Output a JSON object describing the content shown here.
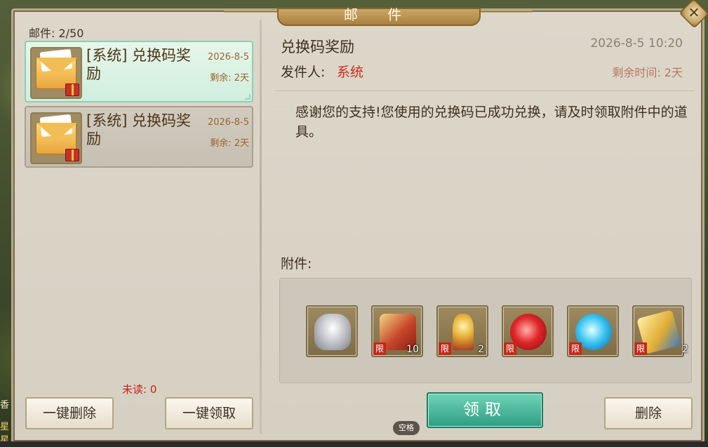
{
  "window": {
    "title": "邮 件"
  },
  "left": {
    "mail_count_label": "邮件: 2/50",
    "mails": [
      {
        "title": "[系统] 兑换码奖励",
        "date": "2026-8-5",
        "remain": "剩余: 2天",
        "selected": true
      },
      {
        "title": "[系统] 兑换码奖励",
        "date": "2026-8-5",
        "remain": "剩余: 2天",
        "selected": false
      }
    ],
    "unread_label": "未读: 0",
    "delete_all_label": "一键删除",
    "claim_all_label": "一键领取"
  },
  "detail": {
    "subject": "兑换码奖励",
    "datetime": "2026-8-5  10:20",
    "sender_label": "发件人:",
    "sender": "系统",
    "remaining": "剩余时间: 2天",
    "body": "感谢您的支持!您使用的兑换码已成功兑换，请及时领取附件中的道具。",
    "attachments_label": "附件:",
    "attachments": [
      {
        "icon": "silver-ingot-icon",
        "tag": "",
        "qty": ""
      },
      {
        "icon": "scroll-icon",
        "tag": "限",
        "qty": "10"
      },
      {
        "icon": "golden-key-icon",
        "tag": "限",
        "qty": "2"
      },
      {
        "icon": "red-orb-icon",
        "tag": "限",
        "qty": ""
      },
      {
        "icon": "blue-orb-icon",
        "tag": "限",
        "qty": ""
      },
      {
        "icon": "golden-scroll-icon",
        "tag": "限",
        "qty": "2"
      }
    ],
    "claim_label": "领取",
    "delete_label": "删除"
  },
  "hint": {
    "space_key": "空格"
  },
  "side": {
    "left_glyph_1": "香",
    "left_glyph_2": "星",
    "left_glyph_3": "星"
  },
  "colors": {
    "accent_red": "#cc2a1c",
    "claim_green": "#2e9e83",
    "date_brown": "#9c6330"
  }
}
